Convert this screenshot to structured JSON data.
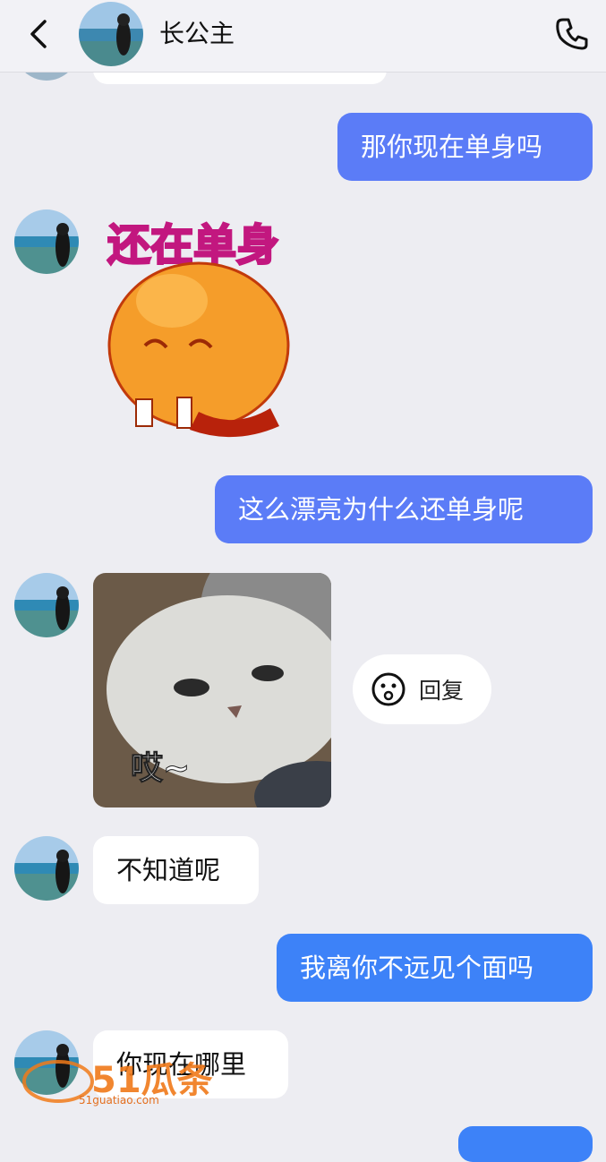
{
  "header": {
    "contact_name": "长公主"
  },
  "messages": [
    {
      "id": "m1",
      "direction": "outgoing",
      "type": "text",
      "text": "那你现在单身吗"
    },
    {
      "id": "m2",
      "direction": "incoming",
      "type": "sticker",
      "caption": "还在单身"
    },
    {
      "id": "m3",
      "direction": "outgoing",
      "type": "text",
      "text": "这么漂亮为什么还单身呢"
    },
    {
      "id": "m4",
      "direction": "incoming",
      "type": "sticker",
      "caption": "哎~"
    },
    {
      "id": "m5",
      "direction": "incoming",
      "type": "text",
      "text": "不知道呢"
    },
    {
      "id": "m6",
      "direction": "outgoing",
      "type": "text",
      "text": "我离你不远见个面吗"
    },
    {
      "id": "m7",
      "direction": "incoming",
      "type": "text",
      "text": "你现在哪里"
    }
  ],
  "reply_button": {
    "label": "回复",
    "icon": "smiley-icon"
  },
  "watermark": {
    "brand": "51瓜条",
    "url": "51guatiao.com"
  },
  "colors": {
    "outgoing_bubble": "#5b7cf7",
    "incoming_bubble": "#ffffff",
    "background": "#ededf2"
  }
}
